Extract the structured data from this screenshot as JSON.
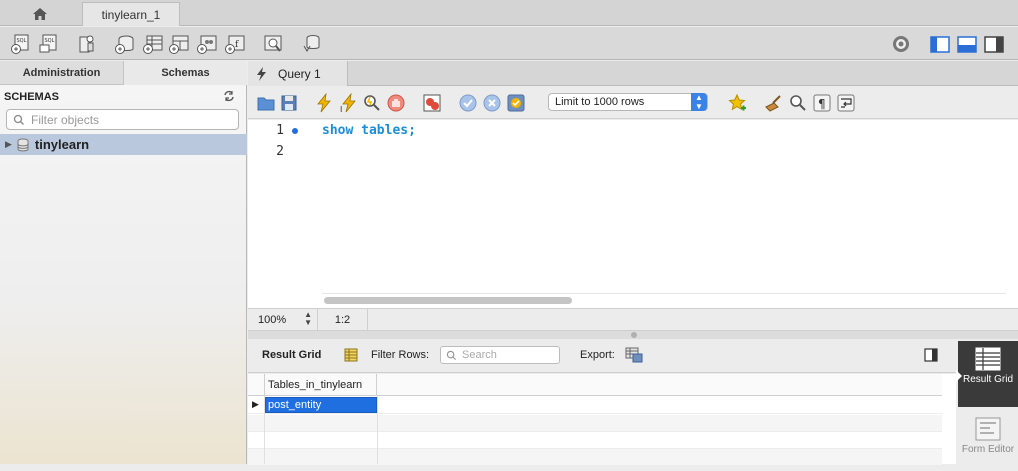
{
  "window": {
    "connection_tab": "tinylearn_1"
  },
  "sidebar": {
    "tabs": [
      {
        "label": "Administration"
      },
      {
        "label": "Schemas"
      }
    ],
    "header": "SCHEMAS",
    "filter_placeholder": "Filter objects",
    "schemas": [
      {
        "name": "tinylearn"
      }
    ]
  },
  "query": {
    "tab_label": "Query 1",
    "limit_select": "Limit to 1000 rows",
    "lines": [
      {
        "number": "1",
        "code": "show tables;"
      },
      {
        "number": "2",
        "code": ""
      }
    ],
    "zoom": "100%",
    "cursor_position": "1:2"
  },
  "results": {
    "view_label": "Result Grid",
    "filter_label": "Filter Rows:",
    "search_placeholder": "Search",
    "export_label": "Export:",
    "columns": [
      "Tables_in_tinylearn"
    ],
    "rows": [
      [
        "post_entity"
      ]
    ],
    "side_buttons": [
      {
        "label": "Result Grid"
      },
      {
        "label": "Form Editor"
      }
    ]
  },
  "colors": {
    "selection": "#1f6fe0",
    "accent": "#3b82e6",
    "keyword": "#1a8fd9"
  }
}
